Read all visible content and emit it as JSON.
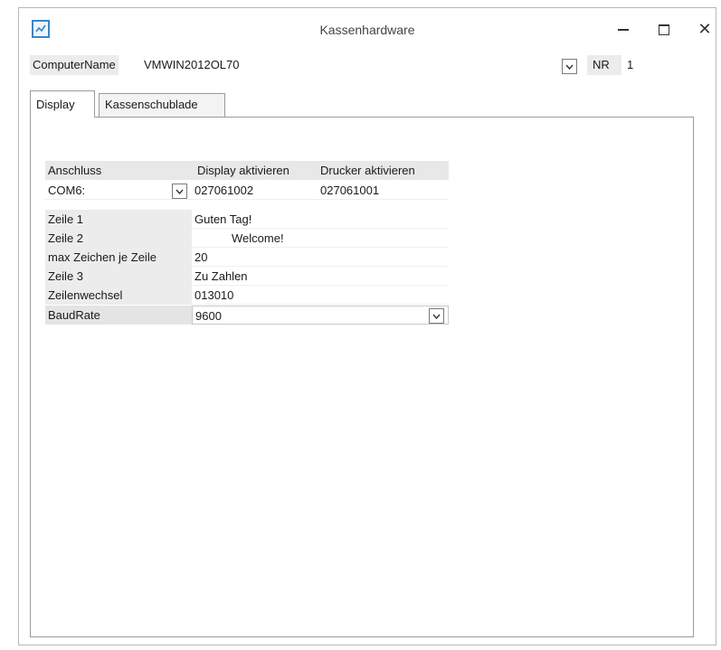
{
  "window": {
    "title": "Kassenhardware"
  },
  "header": {
    "computer_name_label": "ComputerName",
    "computer_name_value": "VMWIN2012OL70",
    "nr_label": "NR",
    "nr_value": "1"
  },
  "tabs": [
    {
      "label": "Display",
      "active": true
    },
    {
      "label": "Kassenschublade",
      "active": false
    }
  ],
  "connection": {
    "headers": {
      "port": "Anschluss",
      "display": "Display aktivieren",
      "printer": "Drucker aktivieren"
    },
    "port_value": "COM6:",
    "display_value": "027061002",
    "printer_value": "027061001"
  },
  "settings": [
    {
      "label": "Zeile 1",
      "value": "Guten Tag!"
    },
    {
      "label": "Zeile 2",
      "value": "Welcome!"
    },
    {
      "label": "max Zeichen je Zeile",
      "value": "20"
    },
    {
      "label": "Zeile 3",
      "value": "Zu Zahlen"
    },
    {
      "label": "Zeilenwechsel",
      "value": "013010"
    }
  ],
  "baudrate": {
    "label": "BaudRate",
    "value": "9600"
  },
  "colors": {
    "accent": "#3a86c8",
    "label_bg": "#ececec"
  },
  "icons": {
    "app": "app-icon",
    "dropdown": "chevron-down-icon",
    "close": "close-icon",
    "minimize": "minimize-icon",
    "maximize": "maximize-icon"
  }
}
